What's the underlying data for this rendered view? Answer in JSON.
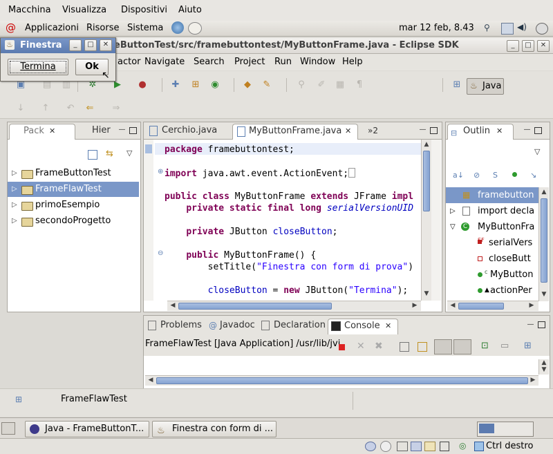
{
  "vbox_menu": [
    "Macchina",
    "Visualizza",
    "Dispositivi",
    "Aiuto"
  ],
  "gnome_panel": {
    "menus": [
      "Applicazioni",
      "Risorse",
      "Sistema"
    ],
    "clock": "mar 12 feb,  8.43"
  },
  "eclipse": {
    "title": "eButtonTest/src/framebuttontest/MyButtonFrame.java - Eclipse SDK",
    "menu": [
      "actor",
      "Navigate",
      "Search",
      "Project",
      "Run",
      "Window",
      "Help"
    ],
    "perspective": "Java"
  },
  "package_view": {
    "tabs": [
      "Pack",
      "Hier"
    ],
    "items": [
      {
        "label": "FrameButtonTest",
        "selected": false
      },
      {
        "label": "FrameFlawTest",
        "selected": true
      },
      {
        "label": "primoEsempio",
        "selected": false
      },
      {
        "label": "secondoProgetto",
        "selected": false
      }
    ]
  },
  "editor": {
    "tabs": [
      "Cerchio.java",
      "MyButtonFrame.java",
      "»2"
    ],
    "lines": [
      "package framebuttontest;",
      "import java.awt.event.ActionEvent;",
      "public class MyButtonFrame extends JFrame impl",
      "    private static final long serialVersionUID",
      "    private JButton closeButton;",
      "    public MyButtonFrame() {",
      "        setTitle(\"Finestra con form di prova\")",
      "        closeButton = new JButton(\"Termina\");"
    ]
  },
  "outline": {
    "tab": "Outlin",
    "items": [
      "framebutton",
      "import decla",
      "MyButtonFra",
      "serialVers",
      "closeButt",
      "MyButton",
      "actionPer"
    ]
  },
  "console_view": {
    "tabs": [
      "Problems",
      "Javadoc",
      "Declaration",
      "Console"
    ],
    "launch": "FrameFlawTest [Java Application] /usr/lib/jvi"
  },
  "status_bar": {
    "text": "FrameFlawTest"
  },
  "taskbar": [
    "Java - FrameButtonT...",
    "Finestra con form di ..."
  ],
  "vbox_status": {
    "host_key": "Ctrl destro"
  },
  "dialog": {
    "title": "Finestra",
    "buttons": [
      "Termina",
      "Ok"
    ]
  }
}
